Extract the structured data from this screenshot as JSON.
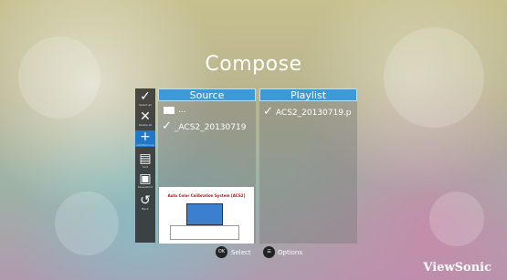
{
  "page": {
    "title": "Compose"
  },
  "toolbar": {
    "items": [
      {
        "label": "Select all",
        "icon": "check-icon"
      },
      {
        "label": "Delete all",
        "icon": "close-icon"
      },
      {
        "label": "Add/Remove",
        "icon": "plus-icon"
      },
      {
        "label": "Sort",
        "icon": "sort-icon"
      },
      {
        "label": "Save/Abort",
        "icon": "save-icon"
      },
      {
        "label": "Back",
        "icon": "back-icon"
      }
    ]
  },
  "source": {
    "title": "Source",
    "parent_entry": "...",
    "file": "_ACS2_20130719",
    "thumbnail_title": "Auto Color Calibration System [ACS2]"
  },
  "playlist": {
    "title": "Playlist",
    "file": "ACS2_20130719.p"
  },
  "footer": {
    "ok_icon": "OK",
    "ok_label": "Select",
    "options_label": "Options"
  },
  "brand": "ViewSonic"
}
